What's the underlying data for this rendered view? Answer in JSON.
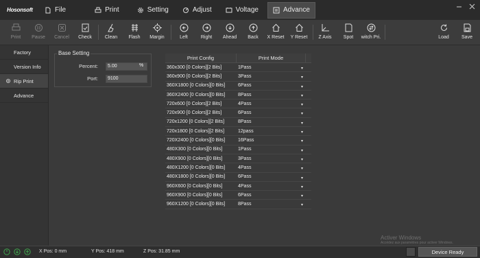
{
  "app": {
    "logo": "Hosonsoft"
  },
  "menu": {
    "tabs": [
      {
        "label": "File",
        "icon": "file-icon"
      },
      {
        "label": "Print",
        "icon": "print-icon"
      },
      {
        "label": "Setting",
        "icon": "gear-icon"
      },
      {
        "label": "Adjust",
        "icon": "adjust-icon"
      },
      {
        "label": "Voltage",
        "icon": "voltage-icon"
      },
      {
        "label": "Advance",
        "icon": "advance-icon",
        "active": true
      }
    ]
  },
  "toolbar": {
    "items": [
      {
        "label": "Print",
        "icon": "print-icon",
        "disabled": true
      },
      {
        "label": "Pause",
        "icon": "pause-icon",
        "disabled": true
      },
      {
        "label": "Cancel",
        "icon": "cancel-icon",
        "disabled": true
      },
      {
        "label": "Check",
        "icon": "check-icon"
      },
      {
        "label": "Clean",
        "icon": "clean-icon"
      },
      {
        "label": "Flash",
        "icon": "flash-icon"
      },
      {
        "label": "Margin",
        "icon": "target-icon"
      },
      {
        "label": "Left",
        "icon": "arrow-left-icon"
      },
      {
        "label": "Right",
        "icon": "arrow-right-icon"
      },
      {
        "label": "Ahead",
        "icon": "arrow-down-icon"
      },
      {
        "label": "Back",
        "icon": "arrow-up-icon"
      },
      {
        "label": "X Reset",
        "icon": "home-icon"
      },
      {
        "label": "Y Reset",
        "icon": "home-icon"
      },
      {
        "label": "Z Axis",
        "icon": "axis-icon"
      },
      {
        "label": "Spot",
        "icon": "spot-icon"
      },
      {
        "label": "witch Pri.",
        "icon": "switch-icon"
      },
      {
        "label": "Load",
        "icon": "refresh-icon"
      },
      {
        "label": "Save",
        "icon": "save-icon"
      }
    ]
  },
  "leftnav": {
    "items": [
      {
        "label": "Factory"
      },
      {
        "label": "Version Info"
      },
      {
        "label": "Rip Print",
        "active": true
      },
      {
        "label": "Advance"
      }
    ]
  },
  "base_setting": {
    "title": "Base Setting",
    "percent_label": "Percent:",
    "percent_value": "5.00",
    "percent_unit": "%",
    "port_label": "Port:",
    "port_value": "9100"
  },
  "table": {
    "headers": [
      "Print Config",
      "Print Mode"
    ],
    "rows": [
      [
        "360x300 [0 Colors][2 Bits]",
        "1Pass"
      ],
      [
        "360x900 [0 Colors][2 Bits]",
        "3Pass"
      ],
      [
        "360X1800 [0 Colors][0 Bits]",
        "6Pass"
      ],
      [
        "360X2400 [0 Colors][0 Bits]",
        "8Pass"
      ],
      [
        "720x600 [0 Colors][2 Bits]",
        "4Pass"
      ],
      [
        "720x900 [0 Colors][2 Bits]",
        "6Pass"
      ],
      [
        "720x1200 [0 Colors][2 Bits]",
        "8Pass"
      ],
      [
        "720x1800 [0 Colors][2 Bits]",
        "12pass"
      ],
      [
        "720X2400 [0 Colors][0 Bits]",
        "16Pass"
      ],
      [
        "480X300 [0 Colors][0 Bits]",
        "1Pass"
      ],
      [
        "480X900 [0 Colors][0 Bits]",
        "3Pass"
      ],
      [
        "480X1200 [0 Colors][0 Bits]",
        "4Pass"
      ],
      [
        "480X1800 [0 Colors][0 Bits]",
        "6Pass"
      ],
      [
        "960X600 [0 Colors][0 Bits]",
        "4Pass"
      ],
      [
        "960X900 [0 Colors][0 Bits]",
        "6Pass"
      ],
      [
        "960X1200 [0 Colors][0 Bits]",
        "8Pass"
      ]
    ]
  },
  "watermark": {
    "line1": "Activer Windows",
    "line2": "Accédez aux paramètres pour activer Windows."
  },
  "status": {
    "x_pos": "X Pos: 0 mm",
    "y_pos": "Y Pos: 418 mm",
    "z_pos": "Z Pos: 31.85 mm",
    "device": "Device Ready"
  },
  "colors": {
    "background": "#3a3a3a",
    "menubar": "#2b2b2b",
    "status_ok": "#3fa34d"
  }
}
